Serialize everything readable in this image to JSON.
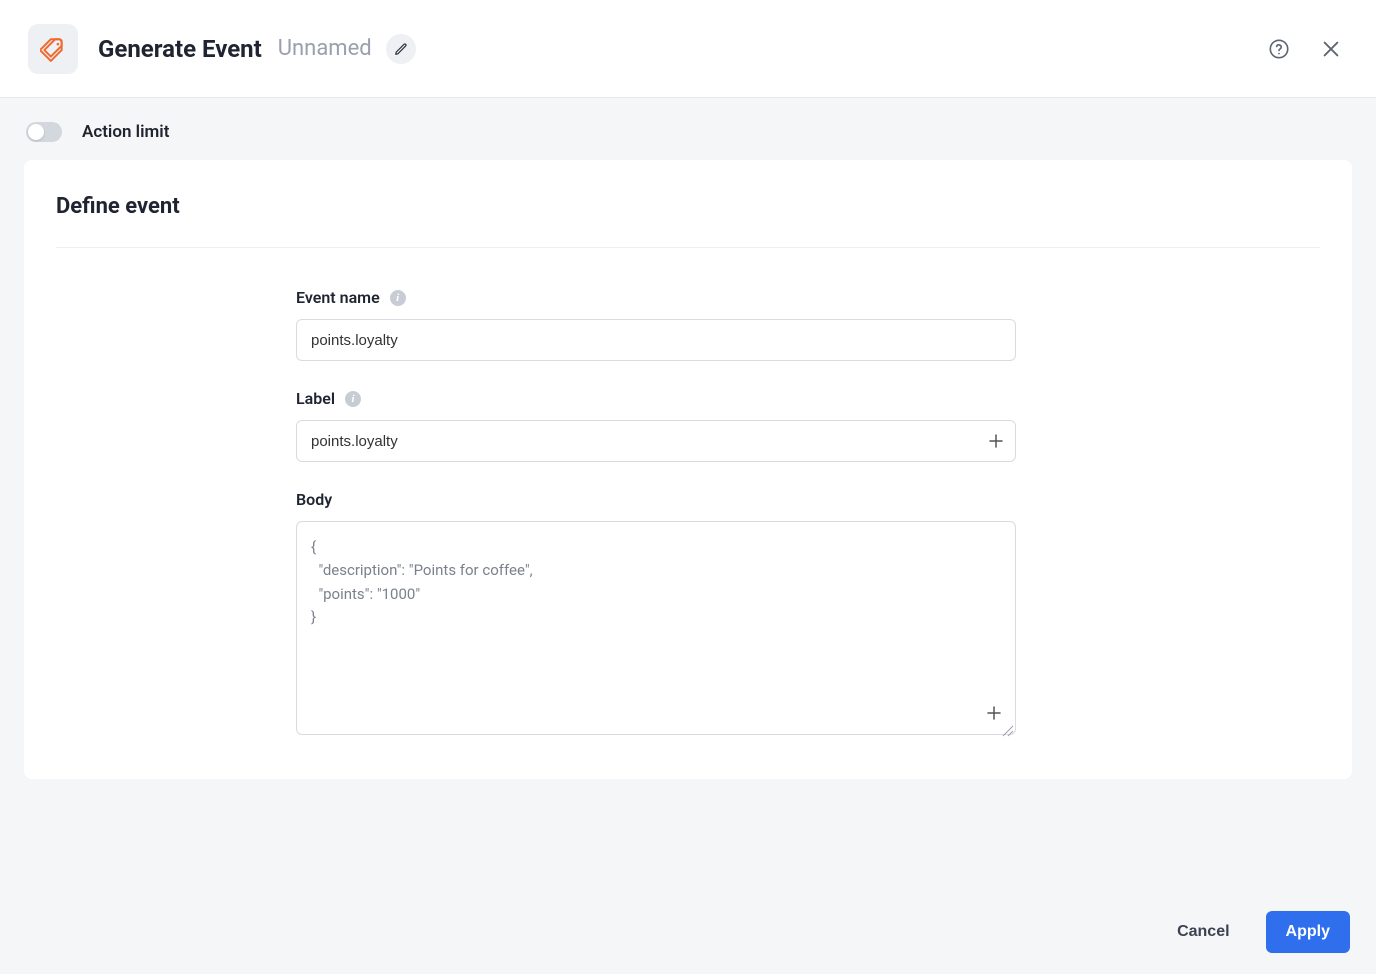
{
  "header": {
    "title": "Generate Event",
    "subtitle": "Unnamed"
  },
  "action_limit": {
    "label": "Action limit",
    "enabled": false
  },
  "card": {
    "title": "Define event"
  },
  "fields": {
    "event_name": {
      "label": "Event name",
      "value": "points.loyalty"
    },
    "label": {
      "label": "Label",
      "value": "points.loyalty"
    },
    "body": {
      "label": "Body",
      "value": "{\n  \"description\": \"Points for coffee\",\n  \"points\": \"1000\"\n}"
    }
  },
  "footer": {
    "cancel": "Cancel",
    "apply": "Apply"
  }
}
